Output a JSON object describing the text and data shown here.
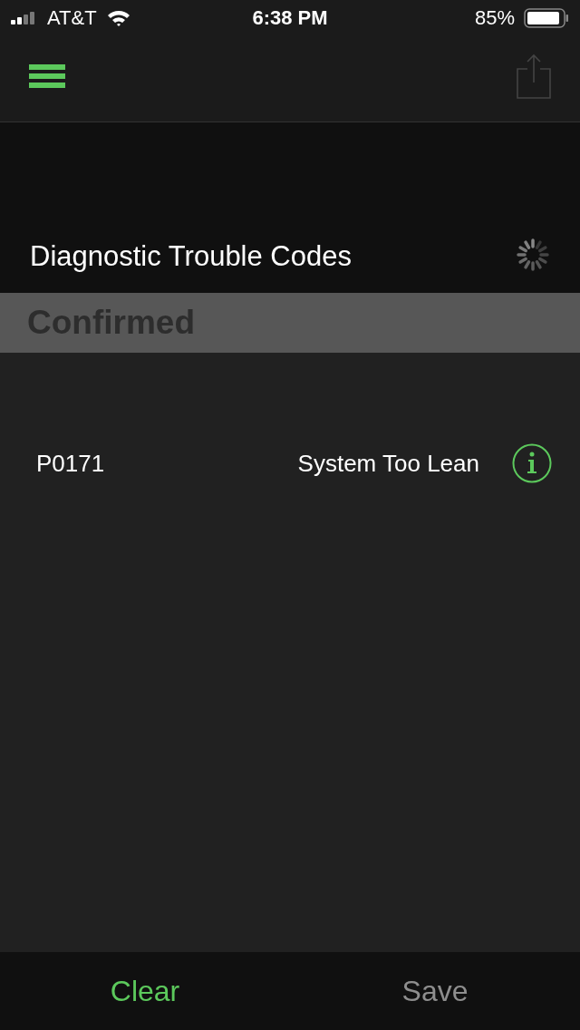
{
  "status_bar": {
    "carrier": "AT&T",
    "time": "6:38 PM",
    "battery": "85%"
  },
  "nav_bar": {
    "share_disabled": true
  },
  "header": {
    "title": "Diagnostic Trouble Codes",
    "loading": true
  },
  "section": {
    "title": "Confirmed"
  },
  "codes": [
    {
      "code": "P0171",
      "description": "System Too Lean"
    }
  ],
  "toolbar": [
    {
      "label": "Clear",
      "disabled": false
    },
    {
      "label": "Save",
      "disabled": true
    }
  ]
}
